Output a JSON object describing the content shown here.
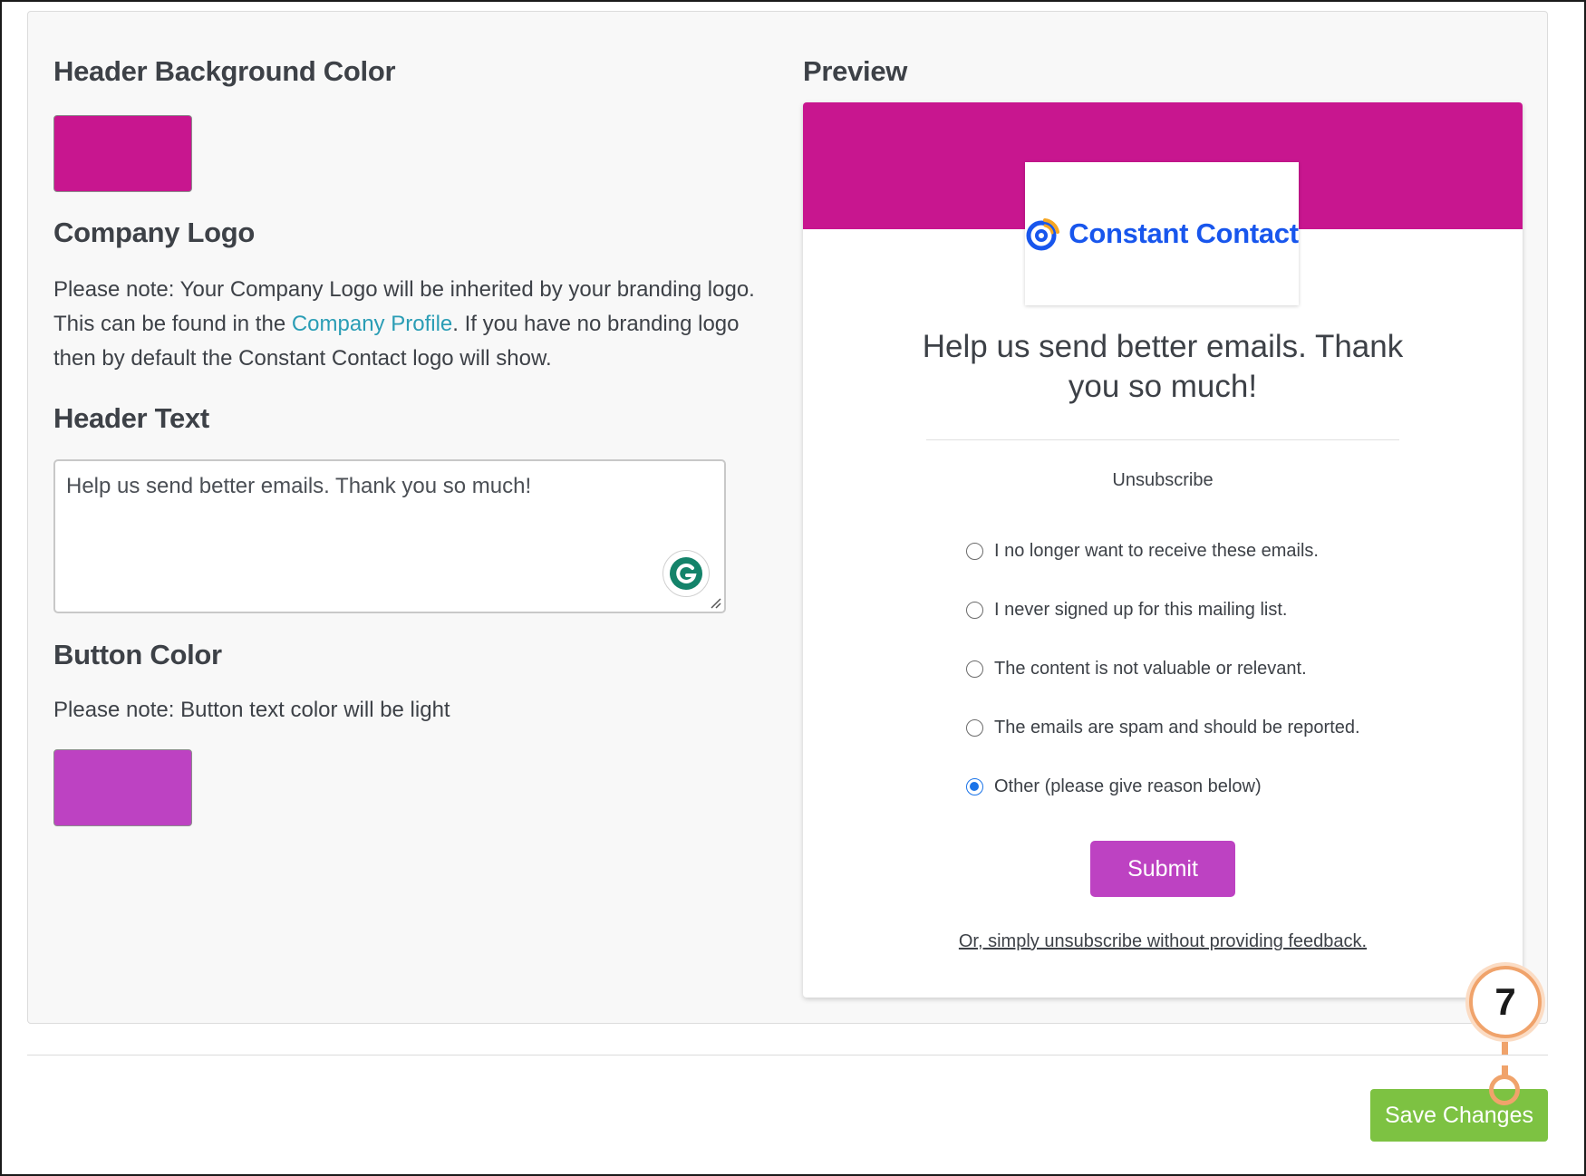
{
  "colors": {
    "header_bg": "#c8168f",
    "button": "#bd42c2",
    "link": "#2a9db5",
    "save_button": "#7dc242",
    "callout": "#f0a36b"
  },
  "settings": {
    "header_bg_title": "Header Background Color",
    "logo_title": "Company Logo",
    "logo_note_pre": "Please note: Your Company Logo will be inherited by your branding logo. This can be found in the ",
    "logo_note_link": "Company Profile",
    "logo_note_post": ". If you have no branding logo then by default the Constant Contact logo will show.",
    "header_text_title": "Header Text",
    "header_text_value": "Help us send better emails.  Thank you so much!",
    "button_color_title": "Button Color",
    "button_color_note": "Please note: Button text color will be light"
  },
  "preview": {
    "title": "Preview",
    "logo_text": "Constant Contact",
    "heading": "Help us send better emails. Thank you so much!",
    "unsubscribe_label": "Unsubscribe",
    "options": [
      {
        "label": "I no longer want to receive these emails.",
        "checked": false
      },
      {
        "label": "I never signed up for this mailing list.",
        "checked": false
      },
      {
        "label": "The content is not valuable or relevant.",
        "checked": false
      },
      {
        "label": "The emails are spam and should be reported.",
        "checked": false
      },
      {
        "label": "Other (please give reason below)",
        "checked": true
      }
    ],
    "submit_label": "Submit",
    "skip_link": "Or, simply unsubscribe without providing feedback."
  },
  "footer": {
    "save_label": "Save Changes",
    "callout_number": "7"
  },
  "icons": {
    "grammarly": "grammarly-icon",
    "resize": "resize-handle-icon",
    "logo": "constant-contact-logo-icon"
  }
}
